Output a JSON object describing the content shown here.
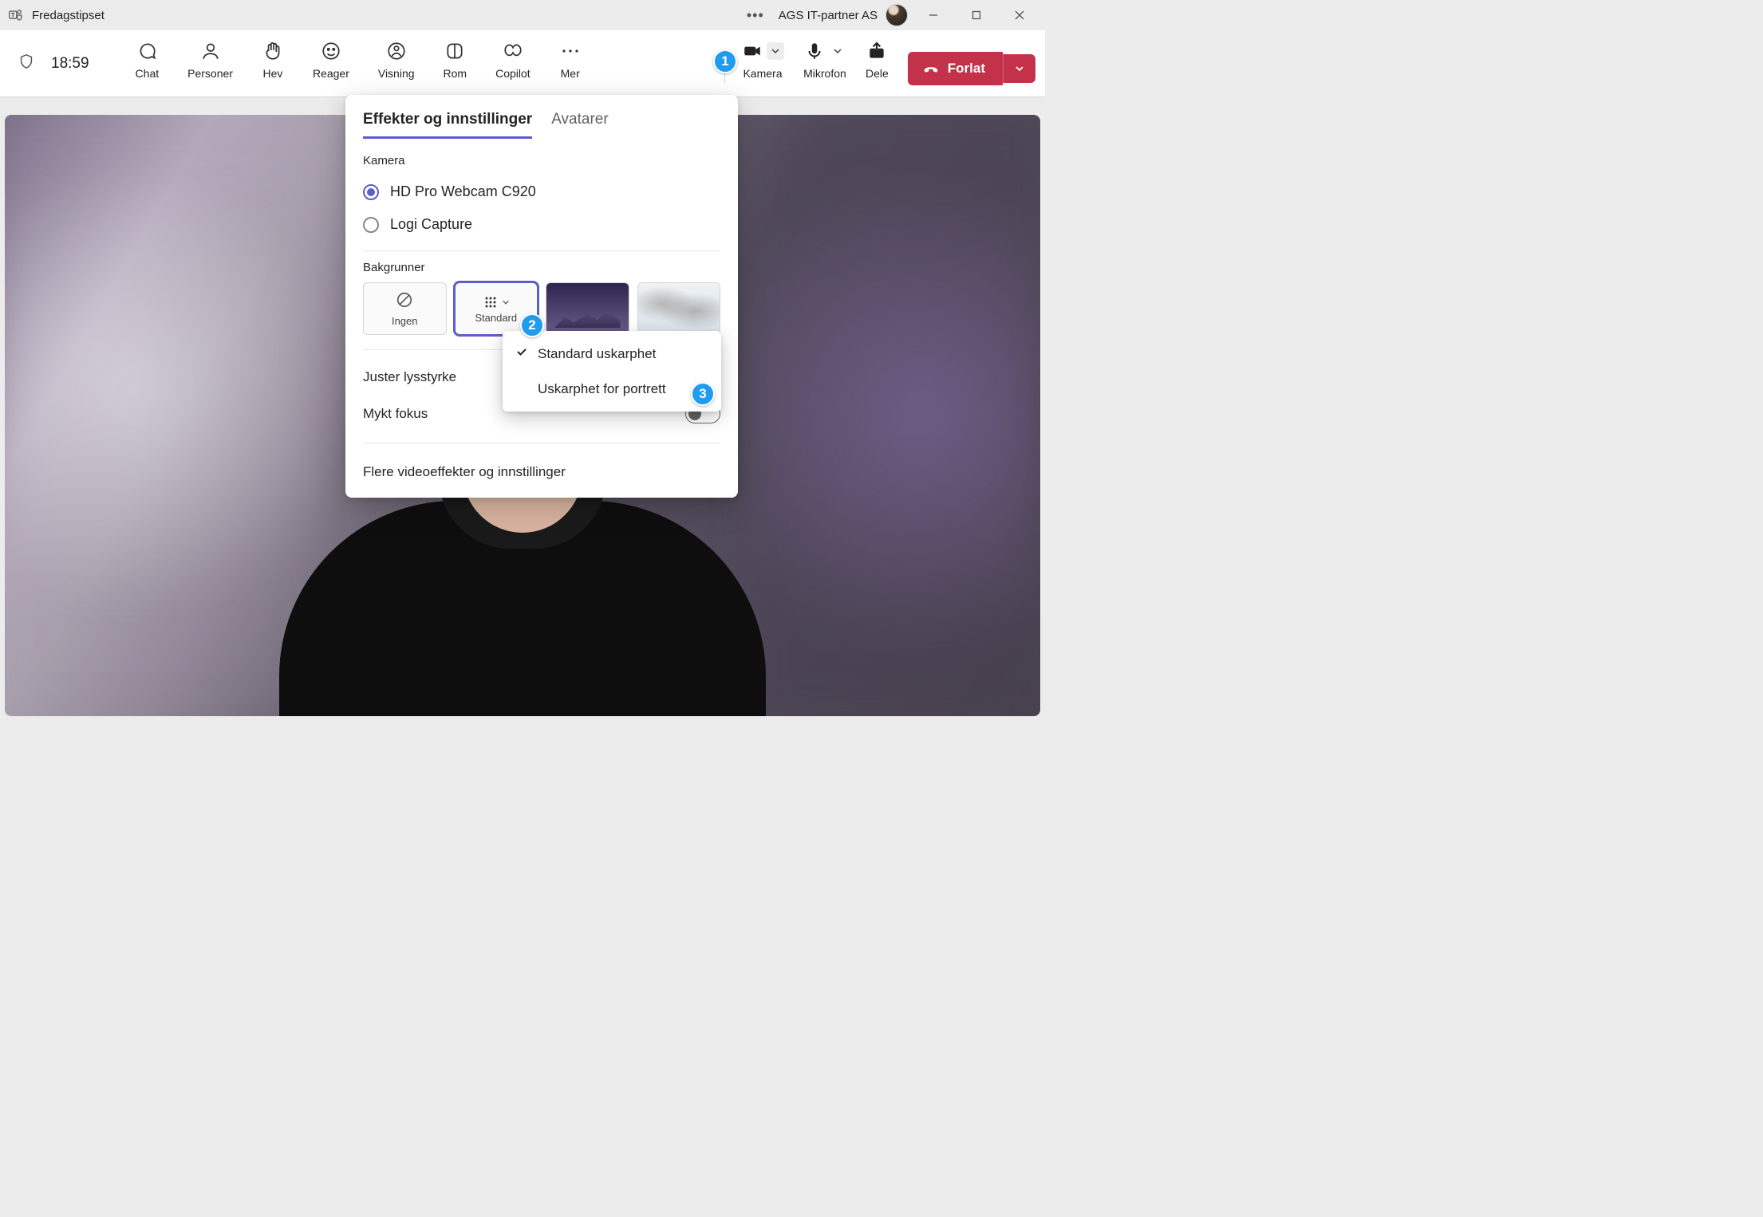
{
  "titlebar": {
    "meeting_title": "Fredagstipset",
    "org_name": "AGS IT-partner AS"
  },
  "toolbar": {
    "time": "18:59",
    "items": [
      {
        "label": "Chat"
      },
      {
        "label": "Personer"
      },
      {
        "label": "Hev"
      },
      {
        "label": "Reager"
      },
      {
        "label": "Visning"
      },
      {
        "label": "Rom"
      },
      {
        "label": "Copilot"
      },
      {
        "label": "Mer"
      }
    ],
    "camera_label": "Kamera",
    "microphone_label": "Mikrofon",
    "share_label": "Dele",
    "leave_label": "Forlat"
  },
  "popover": {
    "tabs": {
      "effects": "Effekter og innstillinger",
      "avatars": "Avatarer"
    },
    "camera_section": "Kamera",
    "cameras": [
      {
        "label": "HD Pro Webcam C920",
        "checked": true
      },
      {
        "label": "Logi Capture",
        "checked": false
      }
    ],
    "backgrounds_section": "Bakgrunner",
    "bg_none": "Ingen",
    "bg_standard": "Standard",
    "brightness_label": "Juster lysstyrke",
    "soft_focus_label": "Mykt fokus",
    "more_link": "Flere videoeffekter og innstillinger"
  },
  "dropdown": {
    "items": [
      {
        "label": "Standard uskarphet",
        "checked": true
      },
      {
        "label": "Uskarphet for portrett",
        "checked": false
      }
    ]
  },
  "annotations": {
    "1": "1",
    "2": "2",
    "3": "3"
  }
}
